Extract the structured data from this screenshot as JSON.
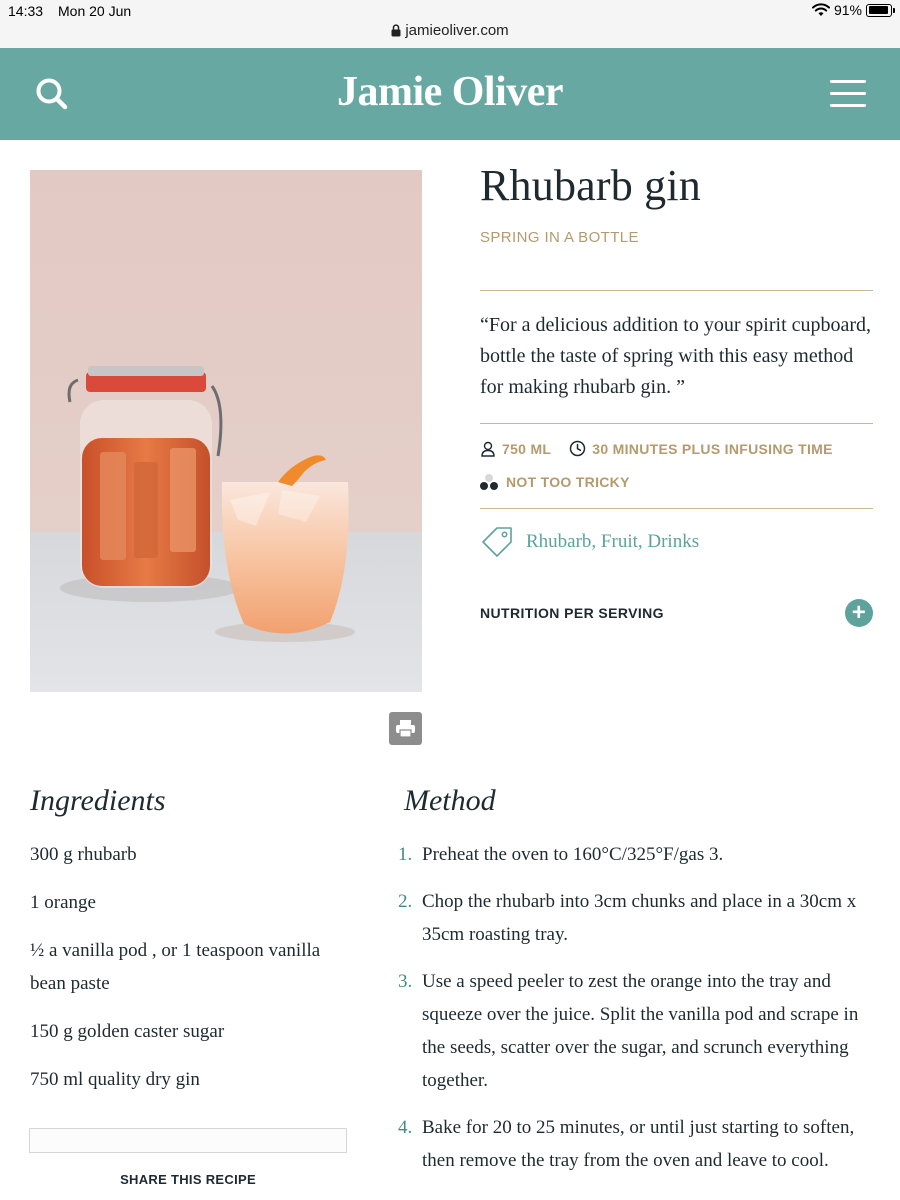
{
  "status_bar": {
    "time": "14:33",
    "date": "Mon 20 Jun",
    "battery": "91%",
    "battery_level": 0.91,
    "url": "jamieoliver.com"
  },
  "header": {
    "logo": "Jamie Oliver",
    "bg_color": "#67a9a2"
  },
  "recipe": {
    "title": "Rhubarb gin",
    "subtitle": "SPRING IN A BOTTLE",
    "quote": "“For a delicious addition to your spirit cupboard, bottle the taste of spring with this easy method for making rhubarb gin. ”",
    "serves": "750 ML",
    "time": "30 MINUTES PLUS INFUSING TIME",
    "difficulty": "NOT TOO TRICKY",
    "tags": "Rhubarb, Fruit, Drinks",
    "nutrition_label": "NUTRITION PER SERVING",
    "nutrition_toggle": "+"
  },
  "ingredients": {
    "title": "Ingredients",
    "items": [
      "300 g rhubarb",
      "1 orange",
      "½ a vanilla pod , or 1 teaspoon vanilla bean paste",
      "150 g golden caster sugar",
      "750 ml quality dry gin"
    ]
  },
  "method": {
    "title": "Method",
    "steps": [
      {
        "num": "1.",
        "text": "Preheat the oven to 160°C/325°F/gas 3."
      },
      {
        "num": "2.",
        "text": "Chop the rhubarb into 3cm chunks and place in a 30cm x 35cm roasting tray."
      },
      {
        "num": "3.",
        "text": "Use a speed peeler to zest the orange into the tray and squeeze over the juice. Split the vanilla pod and scrape in the seeds, scatter over the sugar, and scrunch everything together."
      },
      {
        "num": "4.",
        "text": "Bake for 20 to 25 minutes, or until just starting to soften, then remove the tray from the oven and leave to cool."
      }
    ]
  },
  "share": {
    "label": "SHARE THIS RECIPE"
  },
  "colors": {
    "accent": "#5da39b",
    "gold": "#b49a6d",
    "text": "#1e2a30"
  },
  "icons": [
    "search-icon",
    "menu-icon",
    "lock-icon",
    "wifi-icon",
    "battery-icon",
    "serves-icon",
    "clock-icon",
    "difficulty-icon",
    "tag-icon",
    "plus-icon",
    "print-icon"
  ]
}
